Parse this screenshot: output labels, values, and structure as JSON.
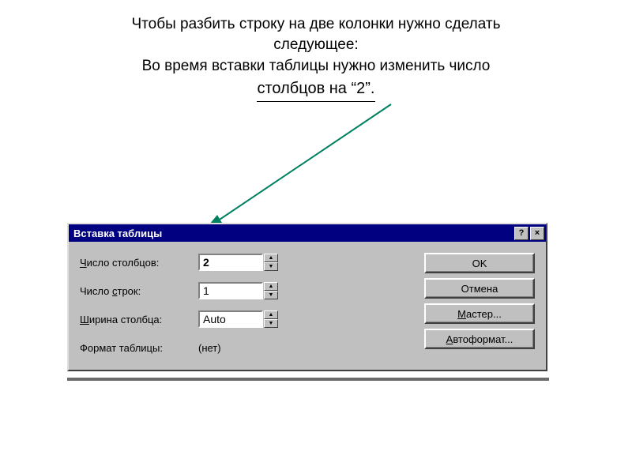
{
  "slide": {
    "title_l1": "Чтобы разбить строку на две колонки нужно сделать",
    "title_l2": "следующее:",
    "subtitle_l1": "Во время вставки таблицы нужно изменить число",
    "subtitle_l2": "столбцов на “2”."
  },
  "dialog": {
    "title": "Вставка таблицы",
    "help_btn": "?",
    "close_btn": "×",
    "fields": {
      "cols_label_pre": "Ч",
      "cols_label_rest": "исло столбцов:",
      "cols_value": "2",
      "rows_label": "Число ",
      "rows_label_u": "с",
      "rows_label_post": "трок:",
      "rows_value": "1",
      "width_label_pre": "Ш",
      "width_label_rest": "ирина столбца:",
      "width_value": "Auto",
      "format_label": "Формат таблицы:",
      "format_value": "(нет)"
    },
    "buttons": {
      "ok": "OK",
      "cancel": "Отмена",
      "wizard_pre": "М",
      "wizard_rest": "астер...",
      "autoformat_pre": "А",
      "autoformat_rest": "втоформат..."
    }
  }
}
